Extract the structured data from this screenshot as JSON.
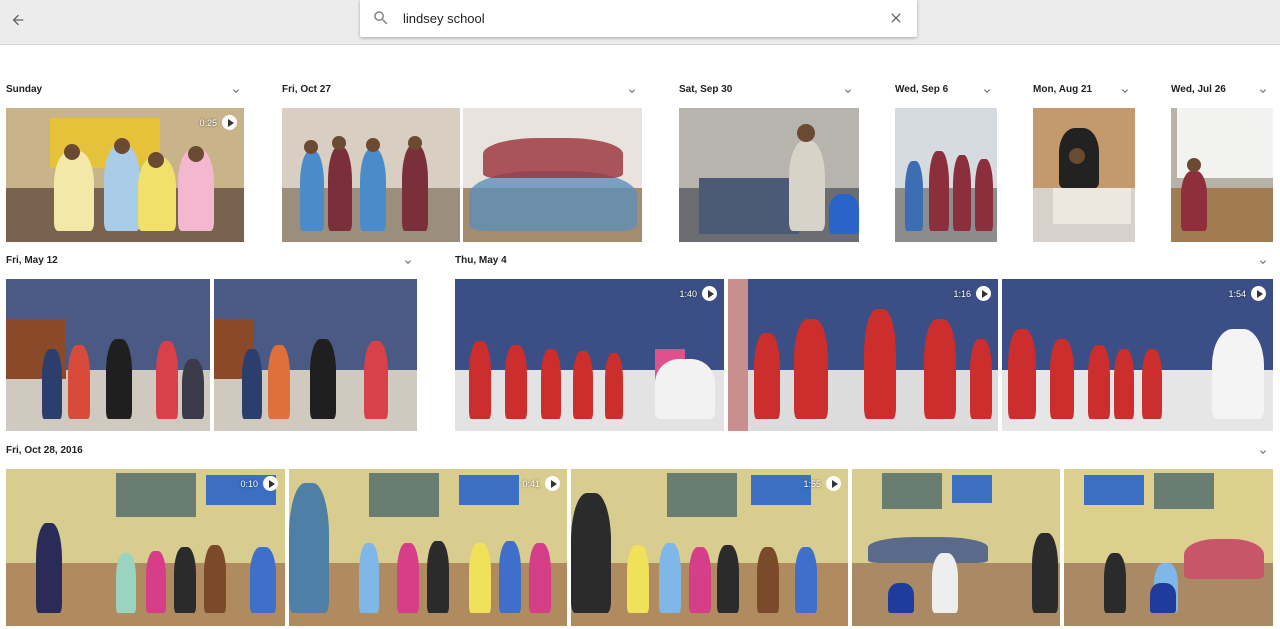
{
  "search": {
    "query": "lindsey school",
    "icon": "search-icon",
    "clear_icon": "close-icon",
    "back_icon": "arrow-back-icon"
  },
  "groups": [
    {
      "title": "Sunday"
    },
    {
      "title": "Fri, Oct 27"
    },
    {
      "title": "Sat, Sep 30"
    },
    {
      "title": "Wed, Sep 6"
    },
    {
      "title": "Mon, Aug 21"
    },
    {
      "title": "Wed, Jul 26"
    },
    {
      "title": "Fri, May 12"
    },
    {
      "title": "Thu, May 4"
    },
    {
      "title": "Fri, Oct 28, 2016"
    }
  ],
  "videos": {
    "v1": "0:25",
    "v2": "1:40",
    "v3": "1:16",
    "v4": "1:54",
    "v5": "0:10",
    "v6": "0:41",
    "v7": "1:55"
  },
  "colors": {
    "header_bg": "#ececec",
    "page_bg": "#ffffff",
    "title_text": "#202124",
    "icon_gray": "#5f6368"
  }
}
